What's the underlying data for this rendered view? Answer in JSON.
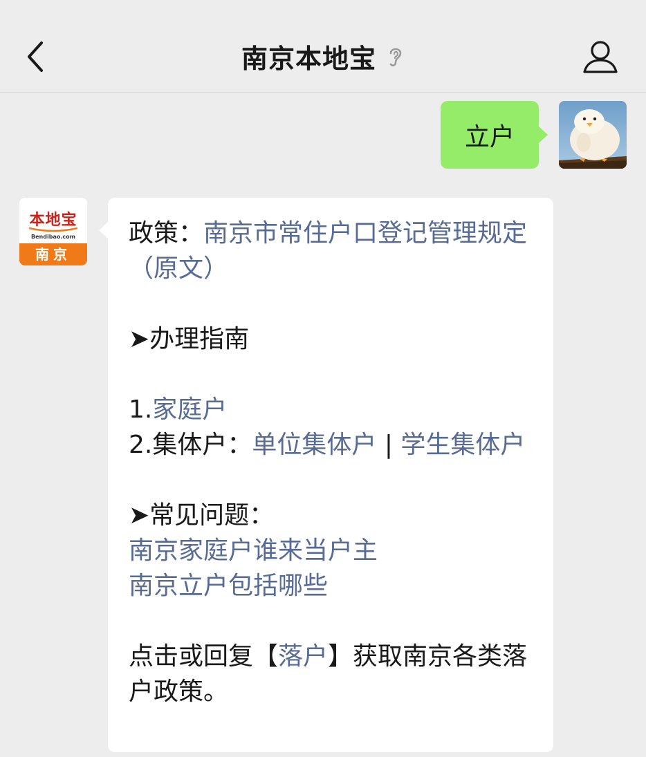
{
  "header": {
    "title": "南京本地宝"
  },
  "user_message": {
    "text": "立户"
  },
  "bot": {
    "avatar": {
      "brand": "本地宝",
      "domain": "Bendibao.com",
      "city": "南京"
    },
    "policy_label": "政策：",
    "policy_link": "南京市常住户口登记管理规定（原文）",
    "guide_heading": "➤办理指南",
    "item1_prefix": "1.",
    "item1_link": "家庭户",
    "item2_prefix": "2.集体户：",
    "item2_link1": "单位集体户",
    "item2_sep": " | ",
    "item2_link2": "学生集体户",
    "faq_heading": "➤常见问题：",
    "faq_link1": "南京家庭户谁来当户主",
    "faq_link2": "南京立户包括哪些",
    "footer_prefix": "点击或回复【",
    "footer_link": "落户",
    "footer_suffix": "】获取南京各类落户政策。"
  },
  "colors": {
    "background": "#ededed",
    "user_bubble": "#95ec69",
    "link": "#576b95",
    "avatar_orange": "#f07a18",
    "avatar_red": "#c8231b"
  },
  "icons": [
    "back-arrow-icon",
    "ear-icon",
    "profile-icon"
  ]
}
